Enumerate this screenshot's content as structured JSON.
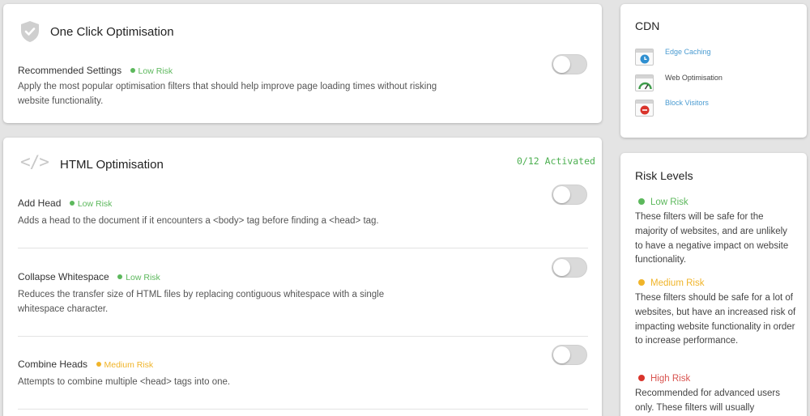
{
  "colors": {
    "low": "#5cb85c",
    "medium": "#f0b429",
    "high": "#d9534f",
    "link": "#4a9bd1",
    "activated": "#4caf50"
  },
  "one_click": {
    "icon": "shield-check-icon",
    "title": "One Click Optimisation",
    "setting": {
      "title": "Recommended Settings",
      "risk": "Low Risk",
      "description": "Apply the most popular optimisation filters that should help improve page loading times without risking website functionality.",
      "enabled": false
    }
  },
  "html_opt": {
    "icon": "code-icon",
    "icon_text": "</>",
    "title": "HTML Optimisation",
    "activated": "0/12 Activated",
    "filters": [
      {
        "title": "Add Head",
        "risk": "Low Risk",
        "risk_level": "low",
        "description": "Adds a head to the document if it encounters a <body> tag before finding a <head> tag.",
        "enabled": false
      },
      {
        "title": "Collapse Whitespace",
        "risk": "Low Risk",
        "risk_level": "low",
        "description": "Reduces the transfer size of HTML files by replacing contiguous whitespace with a single whitespace character.",
        "enabled": false
      },
      {
        "title": "Combine Heads",
        "risk": "Medium Risk",
        "risk_level": "medium",
        "description": "Attempts to combine multiple <head> tags into one.",
        "enabled": false
      }
    ]
  },
  "cdn": {
    "title": "CDN",
    "items": [
      {
        "label": "Edge Caching",
        "icon": "clock-icon",
        "link": true
      },
      {
        "label": "Web Optimisation",
        "icon": "speedometer-icon",
        "link": false
      },
      {
        "label": "Block Visitors",
        "icon": "block-icon",
        "link": true
      }
    ]
  },
  "risk_levels": {
    "title": "Risk Levels",
    "levels": [
      {
        "label": "Low Risk",
        "level": "low",
        "description": "These filters will be safe for the majority of websites, and are unlikely to have a negative impact on website functionality."
      },
      {
        "label": "Medium Risk",
        "level": "medium",
        "description": "These filters should be safe for a lot of websites, but have an increased risk of impacting website functionality in order to increase performance."
      },
      {
        "label": "High Risk",
        "level": "high",
        "description": "Recommended for advanced users only. These filters will usually"
      }
    ]
  }
}
